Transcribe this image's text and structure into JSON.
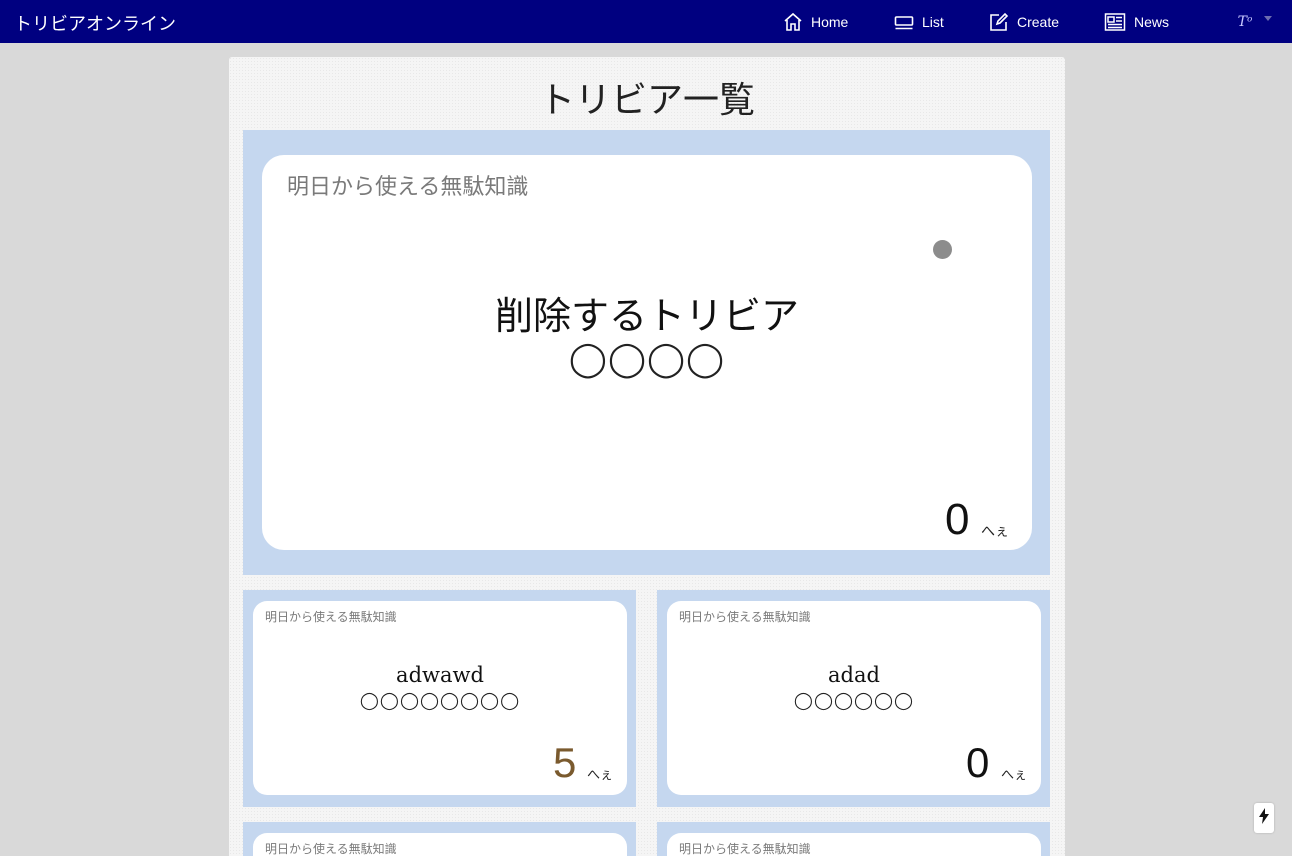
{
  "navbar": {
    "brand": "トリビアオンライン",
    "items": [
      {
        "label": "Home",
        "icon": "home-icon"
      },
      {
        "label": "List",
        "icon": "list-icon"
      },
      {
        "label": "Create",
        "icon": "edit-icon"
      },
      {
        "label": "News",
        "icon": "newspaper-icon"
      }
    ],
    "avatar_text": "Tᵒ"
  },
  "page": {
    "title": "トリビア一覧"
  },
  "featured": {
    "label": "明日から使える無駄知識",
    "title": "削除するトリビア",
    "answer": "◯◯◯◯",
    "count": "0",
    "unit": "へぇ"
  },
  "cards": [
    {
      "label": "明日から使える無駄知識",
      "title": "adwawd",
      "answer": "◯◯◯◯◯◯◯◯",
      "count": "5",
      "unit": "へぇ",
      "count_color": "#7a5a2e"
    },
    {
      "label": "明日から使える無駄知識",
      "title": "adad",
      "answer": "◯◯◯◯◯◯",
      "count": "0",
      "unit": "へぇ",
      "count_color": "#111111"
    },
    {
      "label": "明日から使える無駄知識"
    },
    {
      "label": "明日から使える無駄知識"
    }
  ],
  "colors": {
    "navbar": "#000080",
    "card_frame": "#c5d7ef",
    "background": "#d9d9d9"
  }
}
